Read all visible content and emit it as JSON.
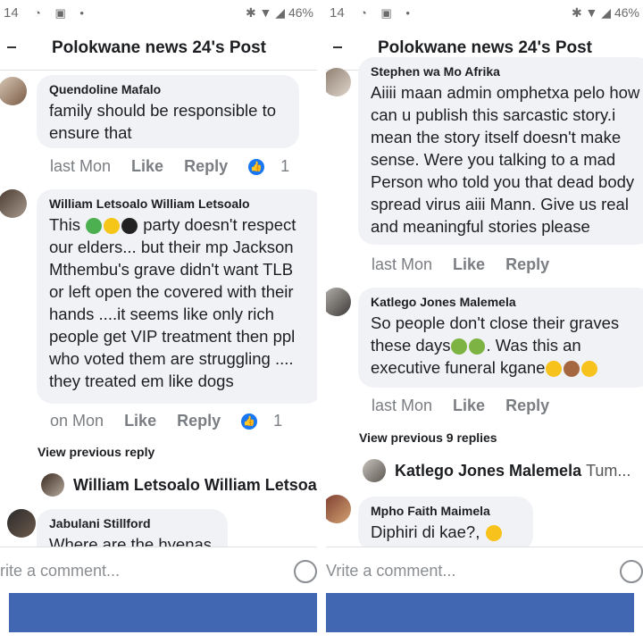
{
  "left": {
    "status": {
      "time": "14",
      "battery": "46%"
    },
    "header": {
      "title": "Polokwane news 24's Post"
    },
    "comments": [
      {
        "author": "Quendoline Mafalo",
        "text": "family should be responsible to ensure that",
        "time": "last Mon",
        "like": "Like",
        "reply": "Reply",
        "likes": "1"
      },
      {
        "author": "William Letsoalo William Letsoalo",
        "text_before": "This",
        "text_after": "party doesn't respect our elders... but their mp Jackson Mthembu's grave didn't want TLB or left open the covered with their hands ....it seems like only rich people get VIP treatment then ppl who voted them are struggling .... they treated em like dogs",
        "time": "on Mon",
        "like": "Like",
        "reply": "Reply",
        "likes": "1"
      }
    ],
    "view_previous": "View previous reply",
    "reply_preview": {
      "author": "William Letsoalo William Letsoal"
    },
    "partial_comment": {
      "author": "Jabulani Stillford",
      "text": "Where are the hyenas"
    },
    "comment_placeholder": "rite a comment..."
  },
  "right": {
    "status": {
      "time": "14",
      "battery": "46%"
    },
    "header": {
      "title": "Polokwane news 24's Post"
    },
    "comments": [
      {
        "author": "Stephen wa Mo Afrika",
        "text": "Aiiii maan admin omphetxa pelo how can u publish this sarcastic story.i mean the story itself doesn't make sense. Were you talking to a mad Person who told you that dead body spread virus aiii Mann. Give us real and meaningful stories please",
        "time": "last Mon",
        "like": "Like",
        "reply": "Reply"
      },
      {
        "author": "Katlego Jones Malemela",
        "text_a": "So people don't close their graves these days",
        "text_b": ". Was this an executive funeral kgane",
        "time": "last Mon",
        "like": "Like",
        "reply": "Reply"
      }
    ],
    "view_previous": "View previous 9 replies",
    "reply_preview": {
      "author": "Katlego Jones Malemela",
      "snippet": "Tum..."
    },
    "partial_comment": {
      "author": "Mpho Faith Maimela",
      "text": "Diphiri di kae?,"
    },
    "comment_placeholder": "Vrite a comment..."
  }
}
